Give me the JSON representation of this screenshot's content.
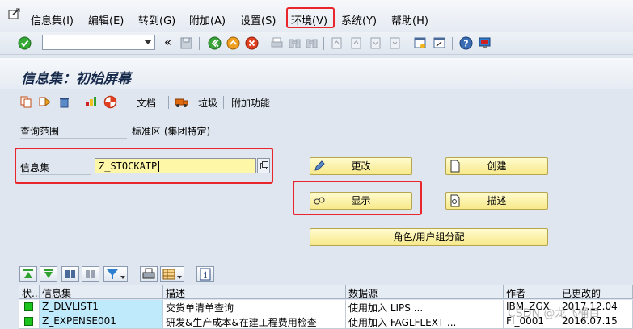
{
  "menu": {
    "items": [
      "信息集(I)",
      "编辑(E)",
      "转到(G)",
      "附加(A)",
      "设置(S)",
      "环境(V)",
      "系统(Y)",
      "帮助(H)"
    ],
    "highlighted": "环境(V)"
  },
  "toolbar": {
    "command_field_value": "",
    "collapse_glyph": "«"
  },
  "title": "信息集：初始屏幕",
  "app_toolbar": {
    "documents_label": "文档",
    "trash_label": "垃圾",
    "extras_label": "附加功能"
  },
  "form": {
    "query_area_label": "查询范围",
    "query_area_value": "标准区 (集团特定)",
    "infoset_label": "信息集",
    "infoset_value": "Z_STOCKATP"
  },
  "buttons": {
    "change": "更改",
    "create": "创建",
    "display": "显示",
    "describe": "描述",
    "role_assign": "角色/用户组分配"
  },
  "table": {
    "headers": [
      "状...",
      "信息集",
      "描述",
      "数据源",
      "作者",
      "已更改的"
    ],
    "rows": [
      {
        "status": "green",
        "infoset": "Z_DLVLIST1",
        "description": "交货单清单查询",
        "datasource": "使用加入 LIPS ...",
        "author": "IBM_ZGX",
        "changed": "2017.12.04"
      },
      {
        "status": "green",
        "infoset": "Z_EXPENSE001",
        "description": "研发&生产成本&在建工程费用检查",
        "datasource": "使用加入 FAGLFLEXT ...",
        "author": "FI_0001",
        "changed": "2016.07.15"
      }
    ]
  },
  "watermark": "CSDN @龙飞桶目",
  "colors": {
    "highlight_box": "#e8262b",
    "button_yellow": "#f7e98a",
    "input_yellow": "#fff7a8",
    "key_cell_blue": "#bfeafb",
    "status_green": "#1ec41e"
  }
}
